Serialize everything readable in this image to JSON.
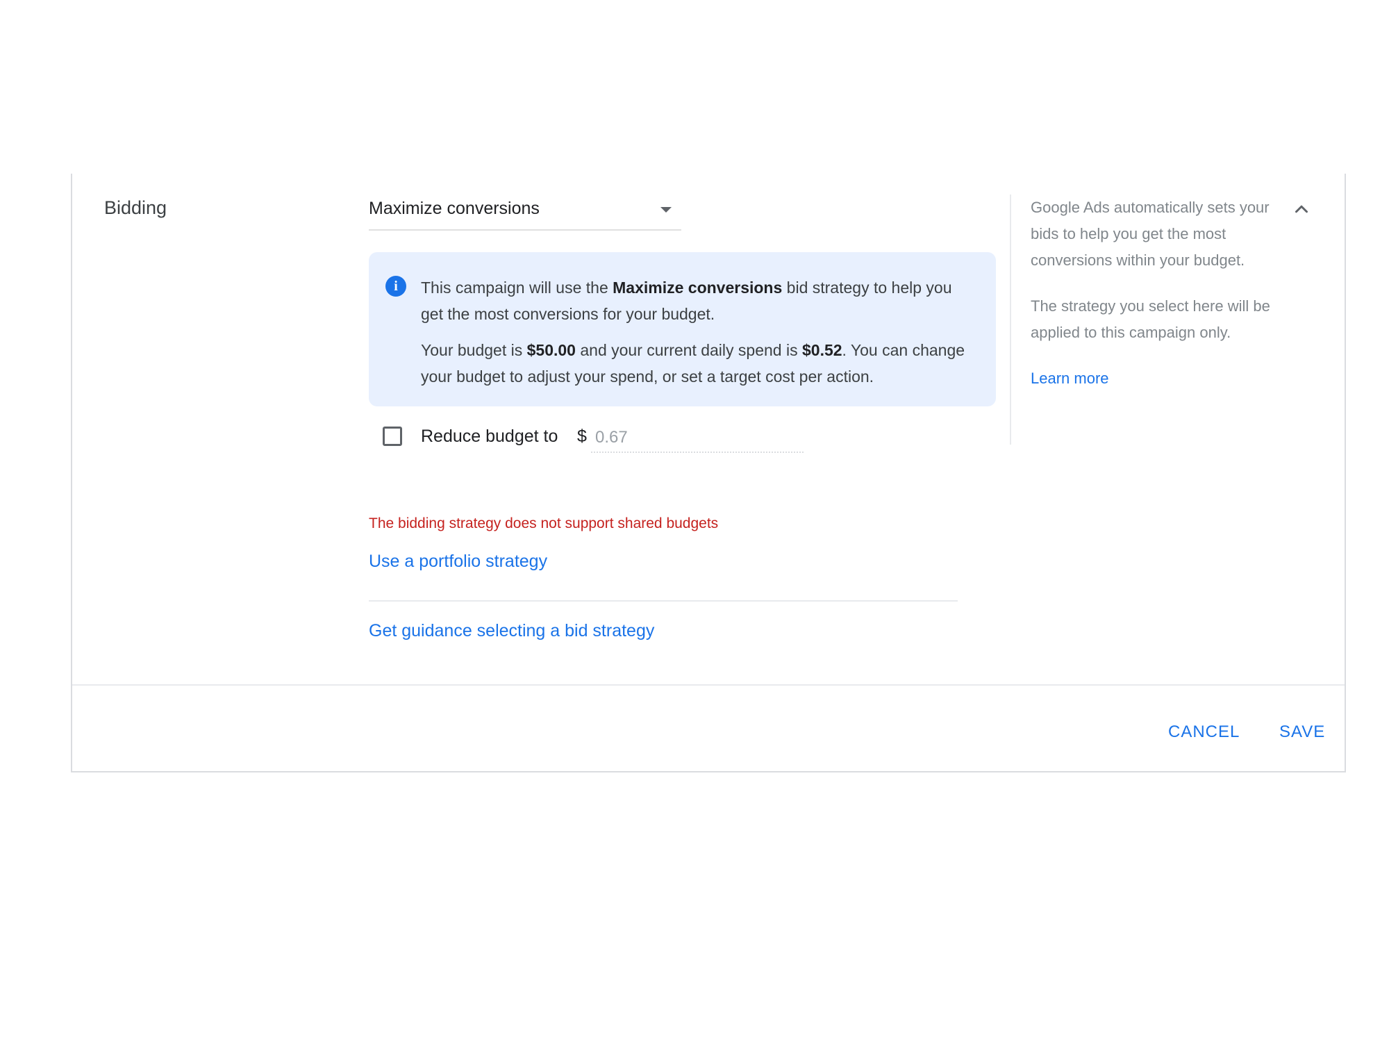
{
  "section": {
    "label": "Bidding"
  },
  "bid_strategy": {
    "selected": "Maximize conversions"
  },
  "info_box": {
    "line1_pre": "This campaign will use the ",
    "line1_bold": "Maximize conversions",
    "line1_post": " bid strategy to help you get the most conversions for your budget.",
    "line2_pre": "Your budget is ",
    "budget_amount": "$50.00",
    "line2_mid": " and your current daily spend is ",
    "daily_spend": "$0.52",
    "line2_post": ". You can change your budget to adjust your spend, or set a target cost per action."
  },
  "reduce_budget": {
    "label": "Reduce budget to",
    "currency": "$",
    "placeholder": "0.67"
  },
  "error": {
    "message": "The bidding strategy does not support shared budgets"
  },
  "links": {
    "portfolio": "Use a portfolio strategy",
    "guidance": "Get guidance selecting a bid strategy",
    "learn_more": "Learn more"
  },
  "side_help": {
    "paragraph1": "Google Ads automatically sets your bids to help you get the most conversions within your budget.",
    "paragraph2": "The strategy you select here will be applied to this campaign only."
  },
  "actions": {
    "cancel": "CANCEL",
    "save": "SAVE"
  },
  "colors": {
    "accent": "#1a73e8",
    "error": "#c5221f",
    "info_background": "#e8f0fe"
  },
  "icons": {
    "info": "info-icon",
    "dropdown": "chevron-down-icon",
    "collapse": "chevron-up-icon"
  }
}
